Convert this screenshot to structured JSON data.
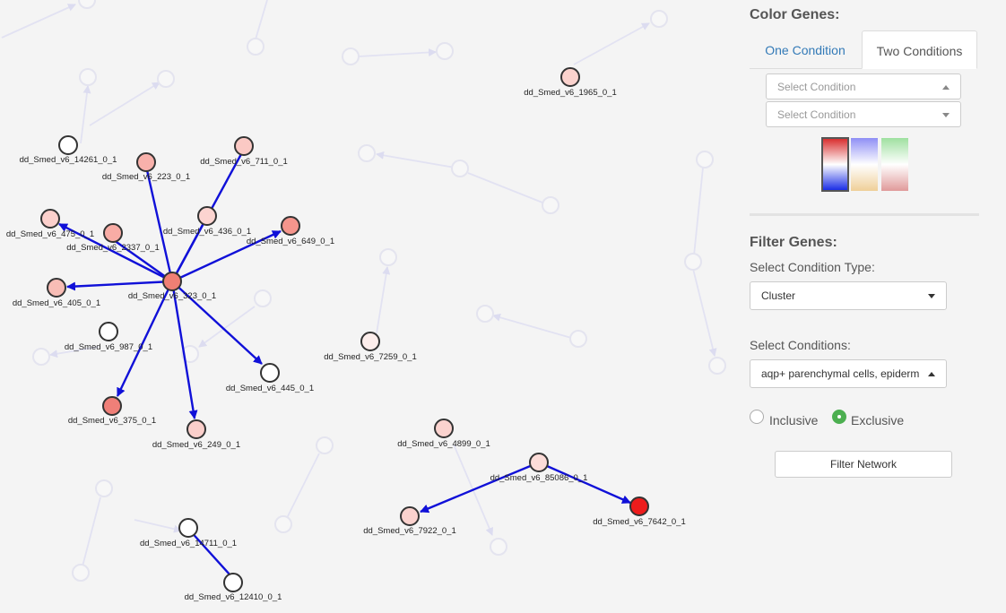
{
  "network": {
    "nodes": [
      {
        "id": "n14261",
        "label": "dd_Smed_v6_14261_0_1",
        "fill": "#ffffff"
      },
      {
        "id": "n223",
        "label": "dd_Smed_v6_223_0_1",
        "fill": "#f8b1ab"
      },
      {
        "id": "n711",
        "label": "dd_Smed_v6_711_0_1",
        "fill": "#fbc9c4"
      },
      {
        "id": "n475",
        "label": "dd_Smed_v6_475_0_1",
        "fill": "#fcd0cc"
      },
      {
        "id": "n2337",
        "label": "dd_Smed_v6_2337_0_1",
        "fill": "#f8aca5"
      },
      {
        "id": "n436",
        "label": "dd_Smed_v6_436_0_1",
        "fill": "#fcd4d0"
      },
      {
        "id": "n649",
        "label": "dd_Smed_v6_649_0_1",
        "fill": "#f5958c"
      },
      {
        "id": "n405",
        "label": "dd_Smed_v6_405_0_1",
        "fill": "#f8bdb6"
      },
      {
        "id": "n323",
        "label": "dd_Smed_v6_323_0_1",
        "fill": "#f07f74"
      },
      {
        "id": "n987",
        "label": "dd_Smed_v6_987_0_1",
        "fill": "#ffffff"
      },
      {
        "id": "n445",
        "label": "dd_Smed_v6_445_0_1",
        "fill": "#ffffff"
      },
      {
        "id": "n375",
        "label": "dd_Smed_v6_375_0_1",
        "fill": "#ef7f78"
      },
      {
        "id": "n249",
        "label": "dd_Smed_v6_249_0_1",
        "fill": "#fbcfcb"
      },
      {
        "id": "n1965",
        "label": "dd_Smed_v6_1965_0_1",
        "fill": "#fbd2cd"
      },
      {
        "id": "n7259",
        "label": "dd_Smed_v6_7259_0_1",
        "fill": "#fdeeec"
      },
      {
        "id": "n4899",
        "label": "dd_Smed_v6_4899_0_1",
        "fill": "#fbd3cf"
      },
      {
        "id": "n85086",
        "label": "dd_Smed_v6_85086_0_1",
        "fill": "#fcdcd8"
      },
      {
        "id": "n7922",
        "label": "dd_Smed_v6_7922_0_1",
        "fill": "#fbd2ce"
      },
      {
        "id": "n7642",
        "label": "dd_Smed_v6_7642_0_1",
        "fill": "#ee1c1c"
      },
      {
        "id": "n14711",
        "label": "dd_Smed_v6_14711_0_1",
        "fill": "#ffffff"
      },
      {
        "id": "n12410",
        "label": "dd_Smed_v6_12410_0_1",
        "fill": "#ffffff"
      }
    ]
  },
  "panel": {
    "color_title": "Color Genes:",
    "tabs": [
      {
        "label": "One Condition"
      },
      {
        "label": "Two Conditions"
      }
    ],
    "select_condition_1_placeholder": "Select Condition",
    "select_condition_2_placeholder": "Select Condition",
    "filter_title": "Filter Genes:",
    "condition_type_label": "Select Condition Type:",
    "condition_type_value": "Cluster",
    "conditions_label": "Select Conditions:",
    "conditions_value": "aqp+ parenchymal cells, epiderm",
    "radio_inclusive": "Inclusive",
    "radio_exclusive": "Exclusive",
    "filter_button": "Filter Network"
  }
}
